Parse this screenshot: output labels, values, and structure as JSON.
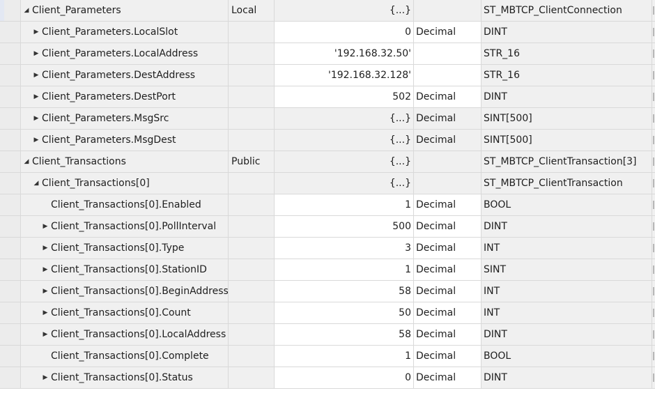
{
  "rows": [
    {
      "name": "Client_Parameters",
      "expander": "expanded",
      "level": 0,
      "usage": "Local",
      "value": "{...}",
      "style": "",
      "data_type": "ST_MBTCP_ClientConnection",
      "kind": "grp"
    },
    {
      "name": "Client_Parameters.LocalSlot",
      "expander": "collapsed",
      "level": 1,
      "usage": "",
      "value": "0",
      "style": "Decimal",
      "data_type": "DINT",
      "kind": "leaf"
    },
    {
      "name": "Client_Parameters.LocalAddress",
      "expander": "collapsed",
      "level": 1,
      "usage": "",
      "value": "'192.168.32.50'",
      "style": "",
      "data_type": "STR_16",
      "kind": "leaf"
    },
    {
      "name": "Client_Parameters.DestAddress",
      "expander": "collapsed",
      "level": 1,
      "usage": "",
      "value": "'192.168.32.128'",
      "style": "",
      "data_type": "STR_16",
      "kind": "leaf"
    },
    {
      "name": "Client_Parameters.DestPort",
      "expander": "collapsed",
      "level": 1,
      "usage": "",
      "value": "502",
      "style": "Decimal",
      "data_type": "DINT",
      "kind": "leaf"
    },
    {
      "name": "Client_Parameters.MsgSrc",
      "expander": "collapsed",
      "level": 1,
      "usage": "",
      "value": "{...}",
      "style": "Decimal",
      "data_type": "SINT[500]",
      "kind": "grp"
    },
    {
      "name": "Client_Parameters.MsgDest",
      "expander": "collapsed",
      "level": 1,
      "usage": "",
      "value": "{...}",
      "style": "Decimal",
      "data_type": "SINT[500]",
      "kind": "grp"
    },
    {
      "name": "Client_Transactions",
      "expander": "expanded",
      "level": 0,
      "usage": "Public",
      "value": "{...}",
      "style": "",
      "data_type": "ST_MBTCP_ClientTransaction[3]",
      "kind": "grp"
    },
    {
      "name": "Client_Transactions[0]",
      "expander": "expanded",
      "level": 1,
      "usage": "",
      "value": "{...}",
      "style": "",
      "data_type": "ST_MBTCP_ClientTransaction",
      "kind": "grp"
    },
    {
      "name": "Client_Transactions[0].Enabled",
      "expander": "none",
      "level": 2,
      "usage": "",
      "value": "1",
      "style": "Decimal",
      "data_type": "BOOL",
      "kind": "leaf"
    },
    {
      "name": "Client_Transactions[0].PollInterval",
      "expander": "collapsed",
      "level": 2,
      "usage": "",
      "value": "500",
      "style": "Decimal",
      "data_type": "DINT",
      "kind": "leaf"
    },
    {
      "name": "Client_Transactions[0].Type",
      "expander": "collapsed",
      "level": 2,
      "usage": "",
      "value": "3",
      "style": "Decimal",
      "data_type": "INT",
      "kind": "leaf"
    },
    {
      "name": "Client_Transactions[0].StationID",
      "expander": "collapsed",
      "level": 2,
      "usage": "",
      "value": "1",
      "style": "Decimal",
      "data_type": "SINT",
      "kind": "leaf"
    },
    {
      "name": "Client_Transactions[0].BeginAddress",
      "expander": "collapsed",
      "level": 2,
      "usage": "",
      "value": "58",
      "style": "Decimal",
      "data_type": "INT",
      "kind": "leaf"
    },
    {
      "name": "Client_Transactions[0].Count",
      "expander": "collapsed",
      "level": 2,
      "usage": "",
      "value": "50",
      "style": "Decimal",
      "data_type": "INT",
      "kind": "leaf"
    },
    {
      "name": "Client_Transactions[0].LocalAddress",
      "expander": "collapsed",
      "level": 2,
      "usage": "",
      "value": "58",
      "style": "Decimal",
      "data_type": "DINT",
      "kind": "leaf"
    },
    {
      "name": "Client_Transactions[0].Complete",
      "expander": "none",
      "level": 2,
      "usage": "",
      "value": "1",
      "style": "Decimal",
      "data_type": "BOOL",
      "kind": "leaf"
    },
    {
      "name": "Client_Transactions[0].Status",
      "expander": "collapsed",
      "level": 2,
      "usage": "",
      "value": "0",
      "style": "Decimal",
      "data_type": "DINT",
      "kind": "leaf"
    }
  ]
}
